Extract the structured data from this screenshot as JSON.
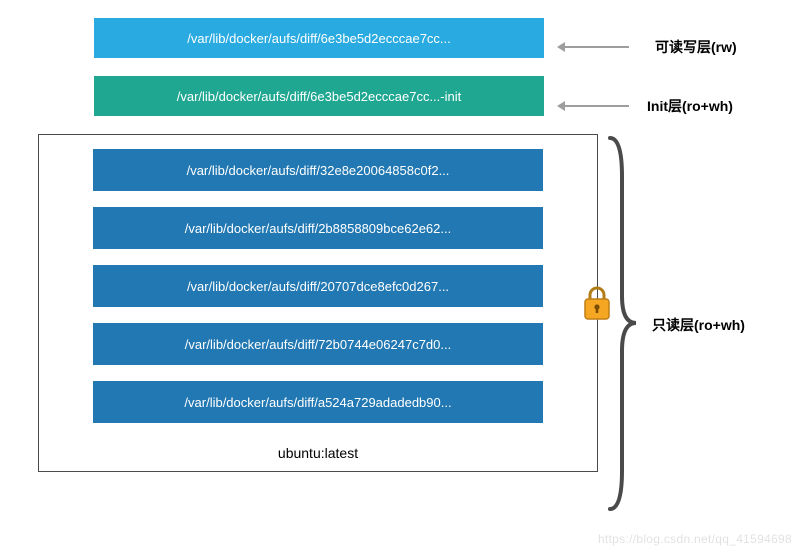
{
  "rw_layer": {
    "path": "/var/lib/docker/aufs/diff/6e3be5d2ecccae7cc...",
    "label": "可读写层(rw)"
  },
  "init_layer": {
    "path": "/var/lib/docker/aufs/diff/6e3be5d2ecccae7cc...-init",
    "label": "Init层(ro+wh)"
  },
  "image": {
    "name": "ubuntu:latest",
    "label": "只读层(ro+wh)",
    "layers": [
      "/var/lib/docker/aufs/diff/32e8e20064858c0f2...",
      "/var/lib/docker/aufs/diff/2b8858809bce62e62...",
      "/var/lib/docker/aufs/diff/20707dce8efc0d267...",
      "/var/lib/docker/aufs/diff/72b0744e06247c7d0...",
      "/var/lib/docker/aufs/diff/a524a729adadedb90..."
    ]
  },
  "watermark": "https://blog.csdn.net/qq_41594698"
}
